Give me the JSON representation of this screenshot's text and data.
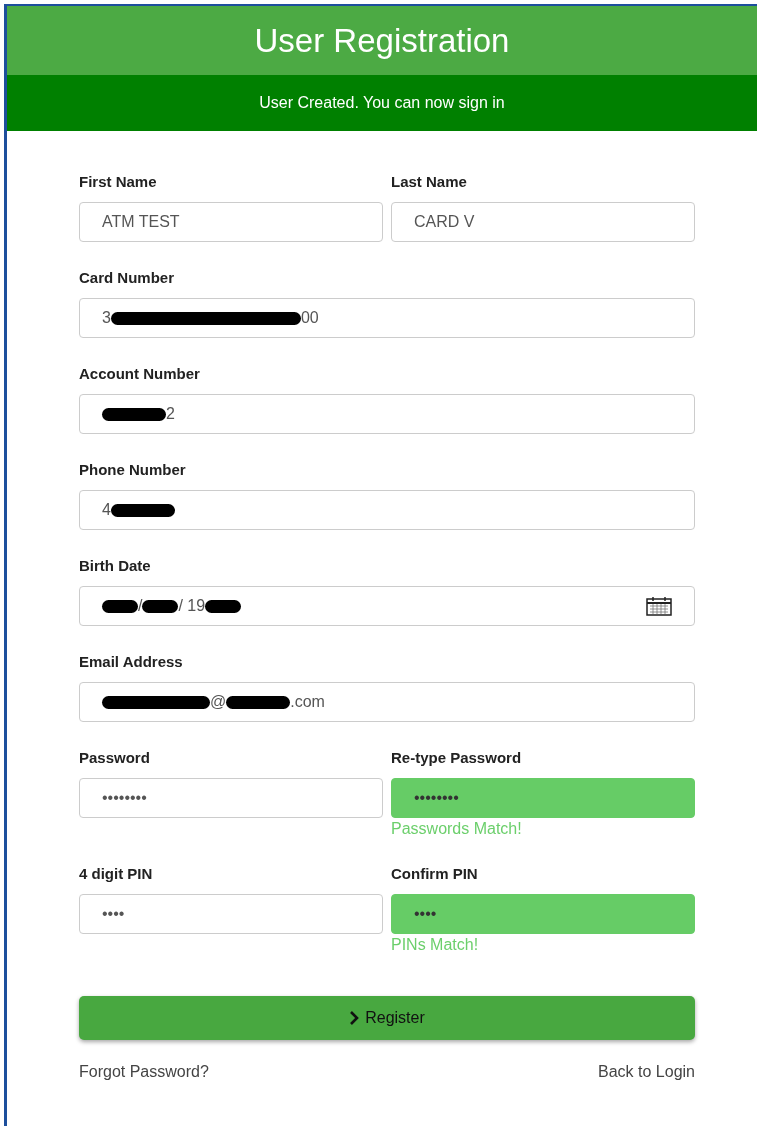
{
  "header": {
    "title": "User Registration"
  },
  "banner": {
    "message": "User Created. You can now sign in"
  },
  "rows": [
    {
      "fields": [
        {
          "label": "First Name",
          "kind": "text",
          "segments": [
            {
              "kind": "text",
              "text": "ATM TEST"
            }
          ]
        },
        {
          "label": "Last Name",
          "kind": "text",
          "segments": [
            {
              "kind": "text",
              "text": "CARD V"
            }
          ]
        }
      ]
    },
    {
      "fields": [
        {
          "label": "Card Number",
          "kind": "text",
          "segments": [
            {
              "kind": "text",
              "text": "3"
            },
            {
              "kind": "xl-redaction"
            },
            {
              "kind": "text",
              "text": "00"
            }
          ]
        }
      ]
    },
    {
      "fields": [
        {
          "label": "Account Number",
          "kind": "text",
          "segments": [
            {
              "kind": "m-redaction"
            },
            {
              "kind": "text",
              "text": "2"
            }
          ]
        }
      ]
    },
    {
      "fields": [
        {
          "label": "Phone Number",
          "kind": "text",
          "segments": [
            {
              "kind": "text",
              "text": "4"
            },
            {
              "kind": "m-redaction"
            }
          ]
        }
      ]
    },
    {
      "fields": [
        {
          "label": "Birth Date",
          "kind": "date",
          "segments": [
            {
              "kind": "s-redaction"
            },
            {
              "kind": "text",
              "text": "/"
            },
            {
              "kind": "s-redaction"
            },
            {
              "kind": "text",
              "text": "/ 19"
            },
            {
              "kind": "s-redaction"
            }
          ]
        }
      ]
    },
    {
      "fields": [
        {
          "label": "Email Address",
          "kind": "text",
          "segments": [
            {
              "kind": "l-redaction"
            },
            {
              "kind": "text",
              "text": "@"
            },
            {
              "kind": "m-redaction"
            },
            {
              "kind": "text",
              "text": ".com"
            }
          ]
        }
      ]
    },
    {
      "fields": [
        {
          "label": "Password",
          "kind": "text",
          "matched": false,
          "segments": [
            {
              "kind": "text",
              "text": "••••••••"
            }
          ]
        },
        {
          "label": "Re-type Password",
          "kind": "text",
          "matched": true,
          "message": "Passwords Match!",
          "segments": [
            {
              "kind": "text",
              "text": "••••••••"
            }
          ]
        }
      ]
    },
    {
      "fields": [
        {
          "label": "4 digit PIN",
          "kind": "text",
          "matched": false,
          "segments": [
            {
              "kind": "text",
              "text": "••••"
            }
          ]
        },
        {
          "label": "Confirm PIN",
          "kind": "text",
          "matched": true,
          "message": "PINs Match!",
          "segments": [
            {
              "kind": "text",
              "text": "••••"
            }
          ]
        }
      ]
    }
  ],
  "register_button": {
    "label": "Register"
  },
  "links": [
    {
      "label": "Forgot Password?"
    },
    {
      "label": "Back to Login"
    }
  ]
}
